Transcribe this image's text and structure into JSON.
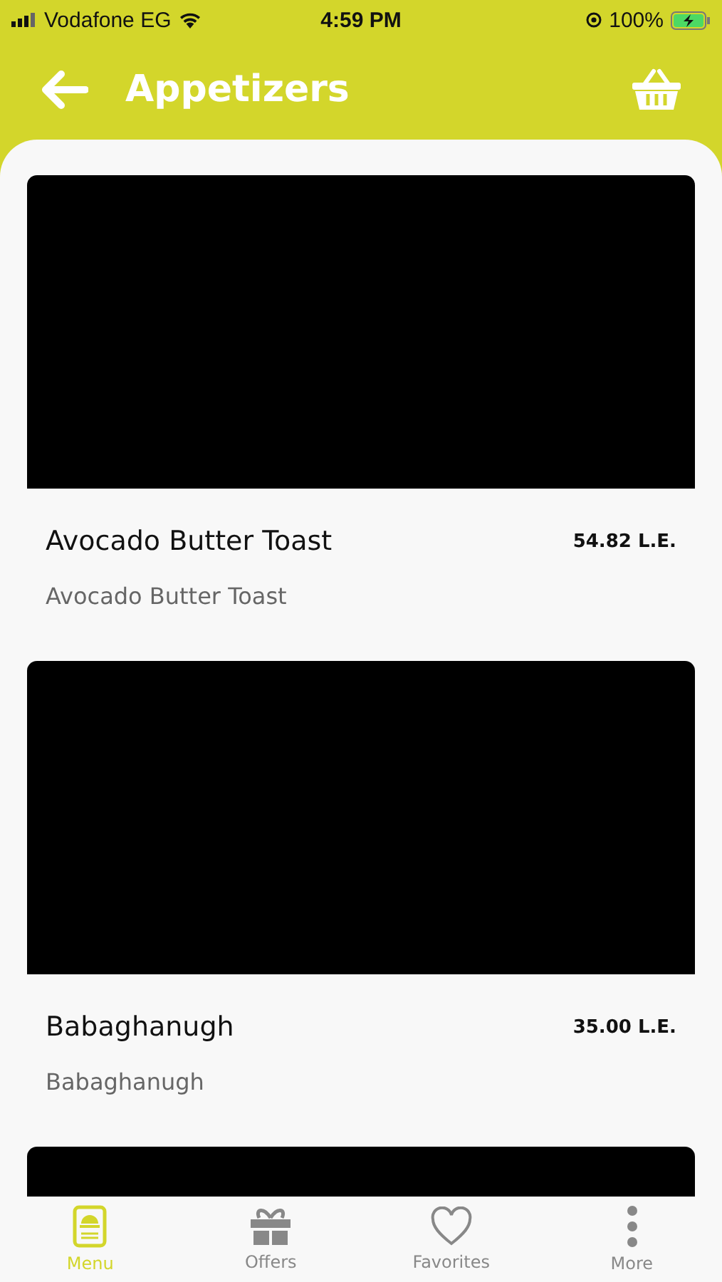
{
  "status_bar": {
    "carrier": "Vodafone EG",
    "time": "4:59 PM",
    "battery": "100%"
  },
  "header": {
    "title": "Appetizers"
  },
  "items": [
    {
      "kind": "dish",
      "name": "Avocado Butter Toast",
      "price": "54.82 L.E.",
      "description": "Avocado Butter Toast"
    },
    {
      "kind": "dish",
      "name": "Babaghanugh",
      "price": "35.00 L.E.",
      "description": "Babaghanugh"
    },
    {
      "kind": "image_only"
    }
  ],
  "tabs": [
    {
      "label": "Menu",
      "kind": "menu",
      "selected": true
    },
    {
      "label": "Offers",
      "kind": "gift",
      "selected": false
    },
    {
      "label": "Favorites",
      "kind": "heart",
      "selected": false
    },
    {
      "label": "More",
      "kind": "more",
      "selected": false
    }
  ]
}
